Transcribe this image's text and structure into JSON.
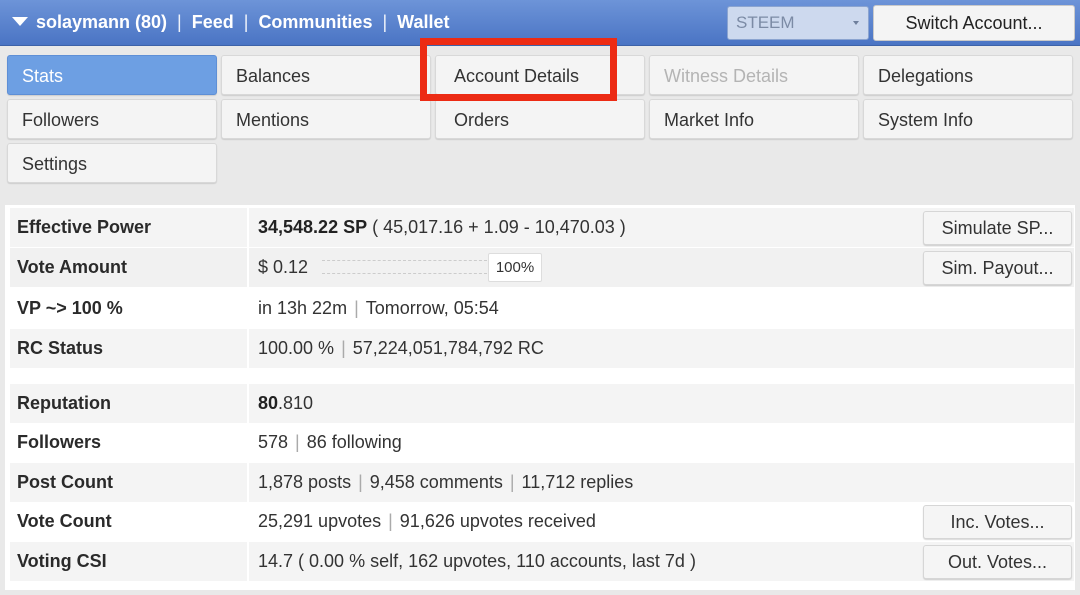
{
  "topbar": {
    "account": "solaymann (80)",
    "links": [
      "Feed",
      "Communities",
      "Wallet"
    ],
    "separator": "|",
    "chain_select": "STEEM",
    "switch_account": "Switch Account..."
  },
  "tabs": [
    {
      "label": "Stats",
      "state": "active"
    },
    {
      "label": "Balances",
      "state": "normal"
    },
    {
      "label": "Account Details",
      "state": "normal"
    },
    {
      "label": "Witness Details",
      "state": "disabled"
    },
    {
      "label": "Delegations",
      "state": "normal"
    },
    {
      "label": "Followers",
      "state": "normal"
    },
    {
      "label": "Mentions",
      "state": "normal"
    },
    {
      "label": "Orders",
      "state": "normal"
    },
    {
      "label": "Market Info",
      "state": "normal"
    },
    {
      "label": "System Info",
      "state": "normal"
    },
    {
      "label": "Settings",
      "state": "normal"
    }
  ],
  "stats": {
    "effective_power": {
      "label": "Effective Power",
      "value_bold": "34,548.22 SP",
      "value_rest": " ( 45,017.16 + 1.09 - 10,470.03 )",
      "button": "Simulate SP..."
    },
    "vote_amount": {
      "label": "Vote Amount",
      "value": "$ 0.12",
      "percent": "100%",
      "slider_level": 1.0,
      "button": "Sim. Payout..."
    },
    "vp": {
      "label": "VP ~> 100 %",
      "part1": "in 13h 22m",
      "part2": "Tomorrow, 05:54"
    },
    "rc_status": {
      "label": "RC Status",
      "part1": "100.00 %",
      "part2": "57,224,051,784,792 RC"
    },
    "reputation": {
      "label": "Reputation",
      "int": "80",
      "dec": ".810"
    },
    "followers": {
      "label": "Followers",
      "part1": "578",
      "part2": "86 following"
    },
    "post_count": {
      "label": "Post Count",
      "part1": "1,878 posts",
      "part2": "9,458 comments",
      "part3": "11,712 replies"
    },
    "vote_count": {
      "label": "Vote Count",
      "part1": "25,291 upvotes",
      "part2": "91,626 upvotes received",
      "button": "Inc. Votes..."
    },
    "voting_csi": {
      "label": "Voting CSI",
      "value": "14.7 ( 0.00 % self, 162 upvotes, 110 accounts, last 7d )",
      "button": "Out. Votes..."
    }
  },
  "colors": {
    "topbar": "#4a74c4",
    "active_tab": "#6d9fe3",
    "highlight": "#ec2b14"
  }
}
